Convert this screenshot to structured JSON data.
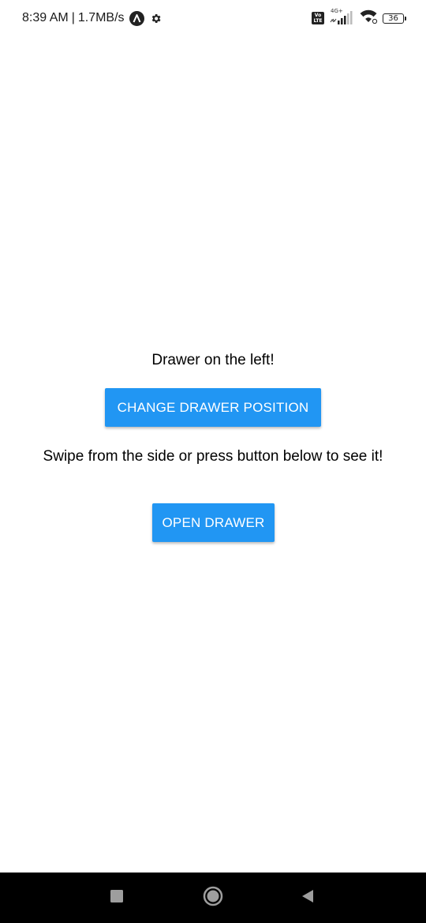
{
  "status_bar": {
    "time": "8:39 AM",
    "separator": "|",
    "net_speed": "1.7MB/s",
    "volte_top": "Vo",
    "volte_bottom": "LTE",
    "network_type": "4G+",
    "battery_level": "36"
  },
  "main": {
    "drawer_position_text": "Drawer on the left!",
    "change_position_button": "CHANGE DRAWER POSITION",
    "instruction_text": "Swipe from the side or press button below to see it!",
    "open_drawer_button": "OPEN DRAWER"
  },
  "colors": {
    "button_bg": "#2196F3",
    "button_text": "#FFFFFF",
    "background": "#FFFFFF",
    "nav_bar": "#000000",
    "nav_icons": "#9E9E9E"
  },
  "icons": {
    "status_app": "a-circle-icon",
    "status_settings": "gear-icon",
    "signal": "cellular-signal-icon",
    "wifi": "wifi-icon",
    "battery": "battery-icon",
    "nav_recent": "square-recents-icon",
    "nav_home": "circle-home-icon",
    "nav_back": "triangle-back-icon"
  }
}
